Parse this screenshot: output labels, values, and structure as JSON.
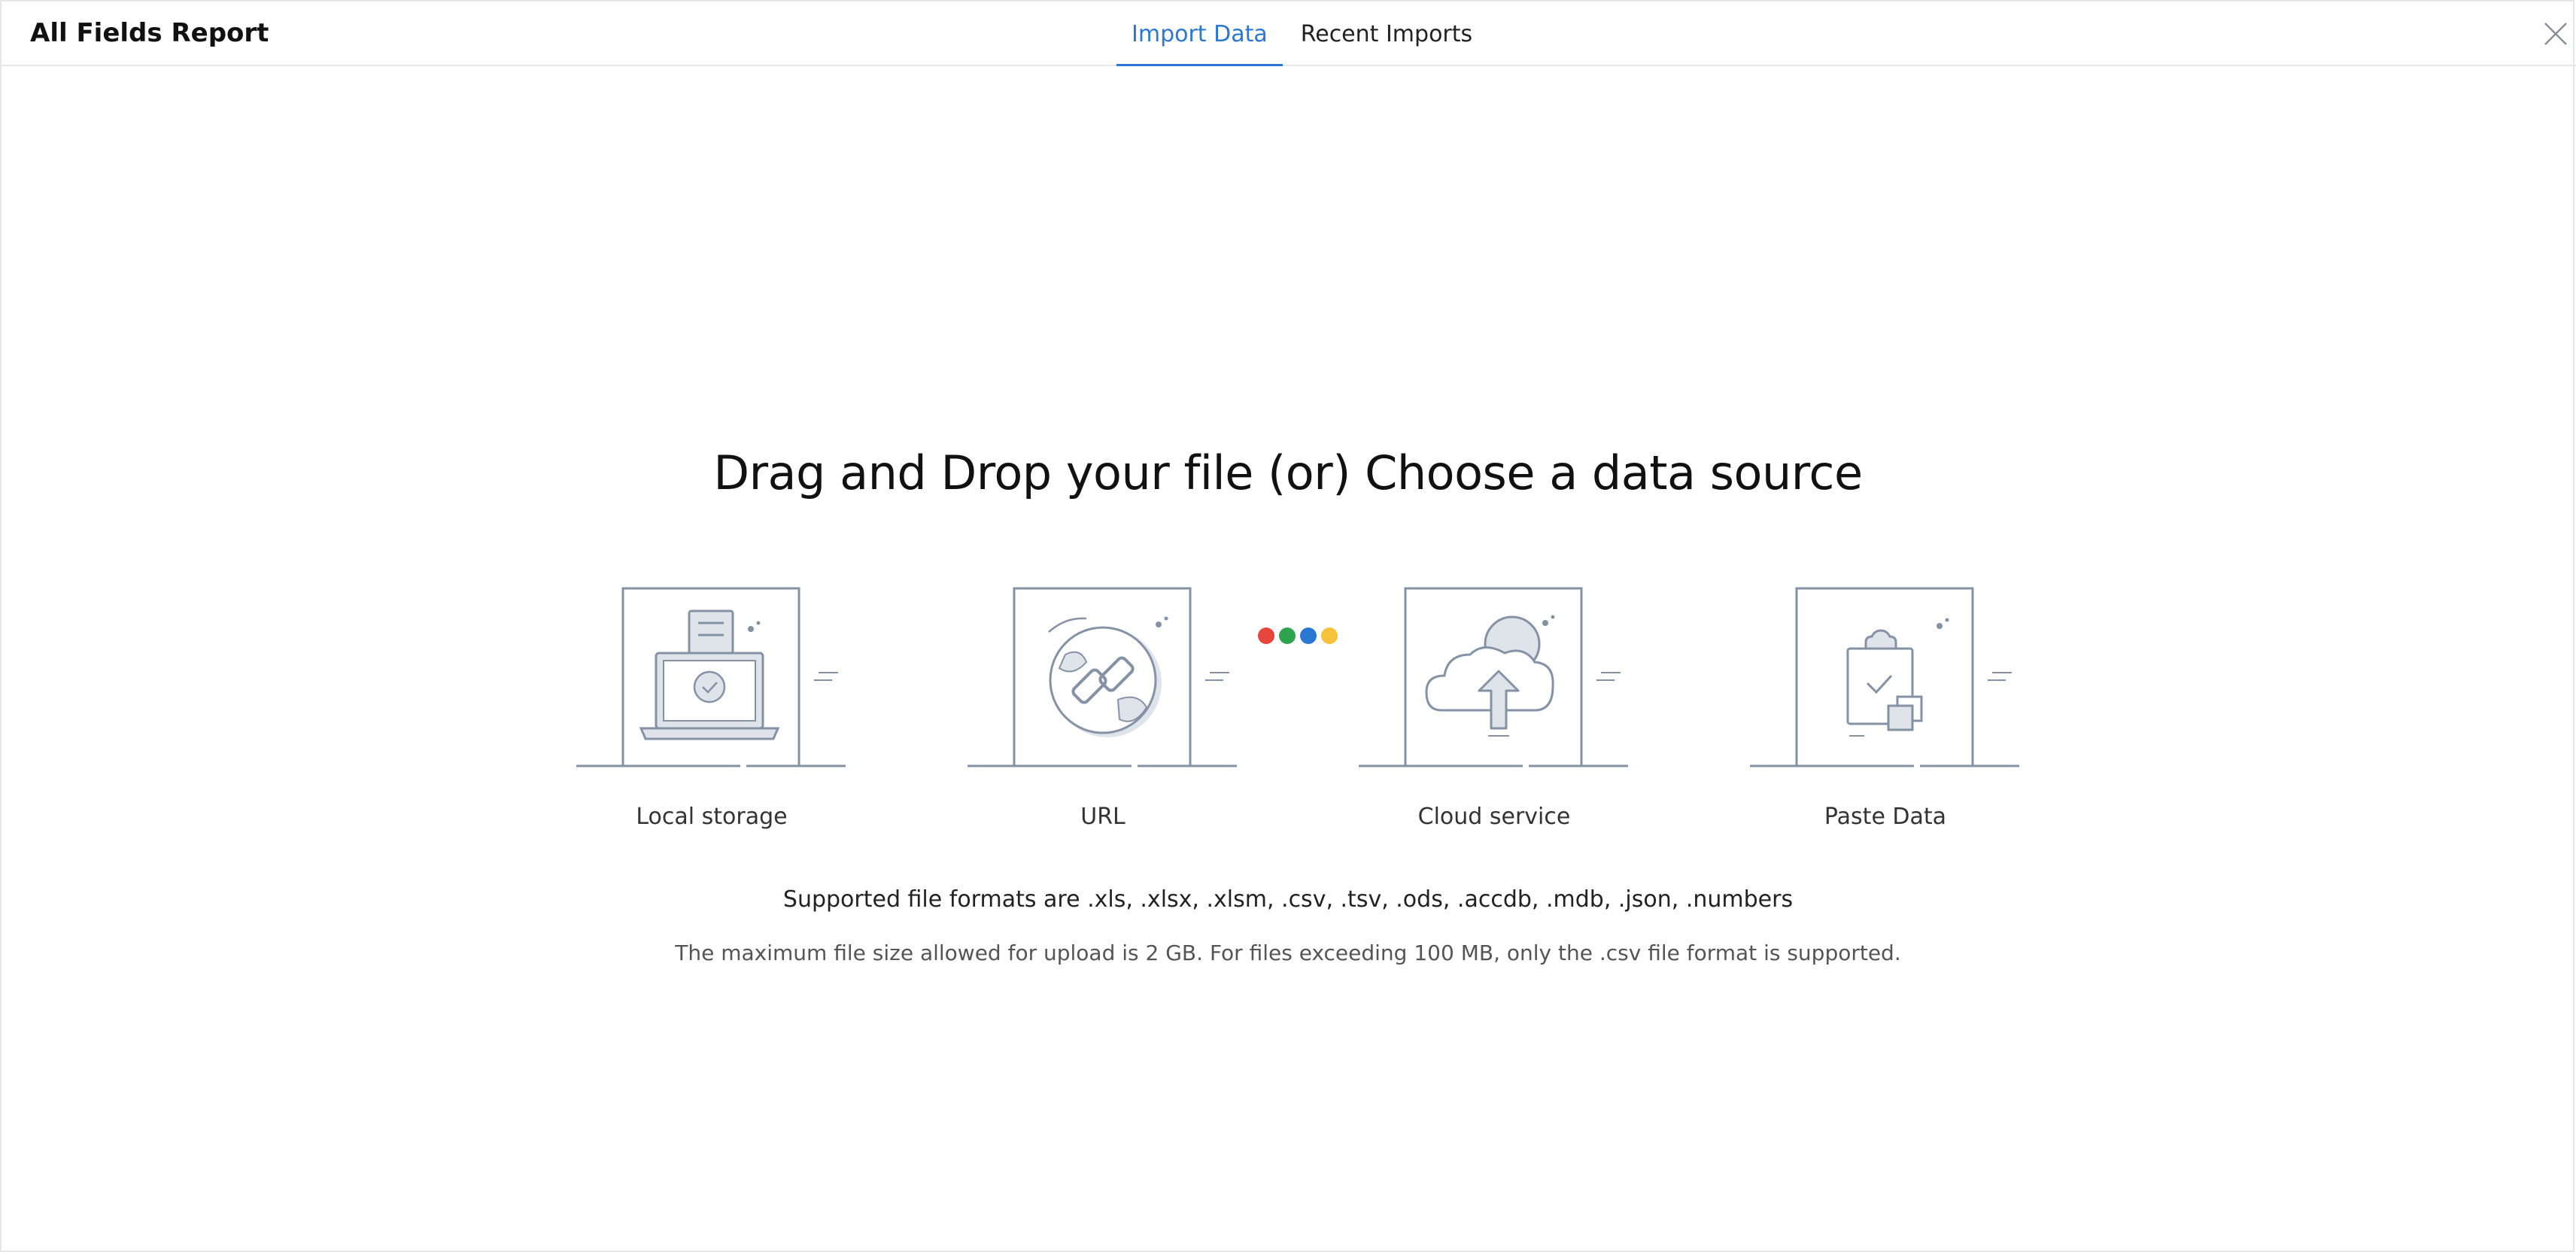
{
  "header": {
    "title": "All Fields Report",
    "tabs": [
      {
        "label": "Import Data",
        "active": true
      },
      {
        "label": "Recent Imports",
        "active": false
      }
    ],
    "close_icon": "close-icon"
  },
  "main": {
    "heading": "Drag and Drop your file (or) Choose a data source",
    "sources": [
      {
        "label": "Local storage",
        "icon": "laptop-upload-icon"
      },
      {
        "label": "URL",
        "icon": "globe-link-icon"
      },
      {
        "label": "Cloud service",
        "icon": "cloud-upload-icon"
      },
      {
        "label": "Paste Data",
        "icon": "clipboard-paste-icon"
      }
    ],
    "cloud_dots_colors": [
      "#e8453c",
      "#2ea44f",
      "#2a78d4",
      "#f5c23a"
    ],
    "formats_text": "Supported file formats are .xls, .xlsx, .xlsm, .csv, .tsv, .ods, .accdb, .mdb, .json, .numbers",
    "limit_text": "The maximum file size allowed for upload is 2 GB. For files exceeding 100 MB, only the .csv file format is supported."
  },
  "colors": {
    "accent": "#2a78d4",
    "illustration_stroke": "#8592a6",
    "illustration_fill": "#dfe4ea"
  }
}
